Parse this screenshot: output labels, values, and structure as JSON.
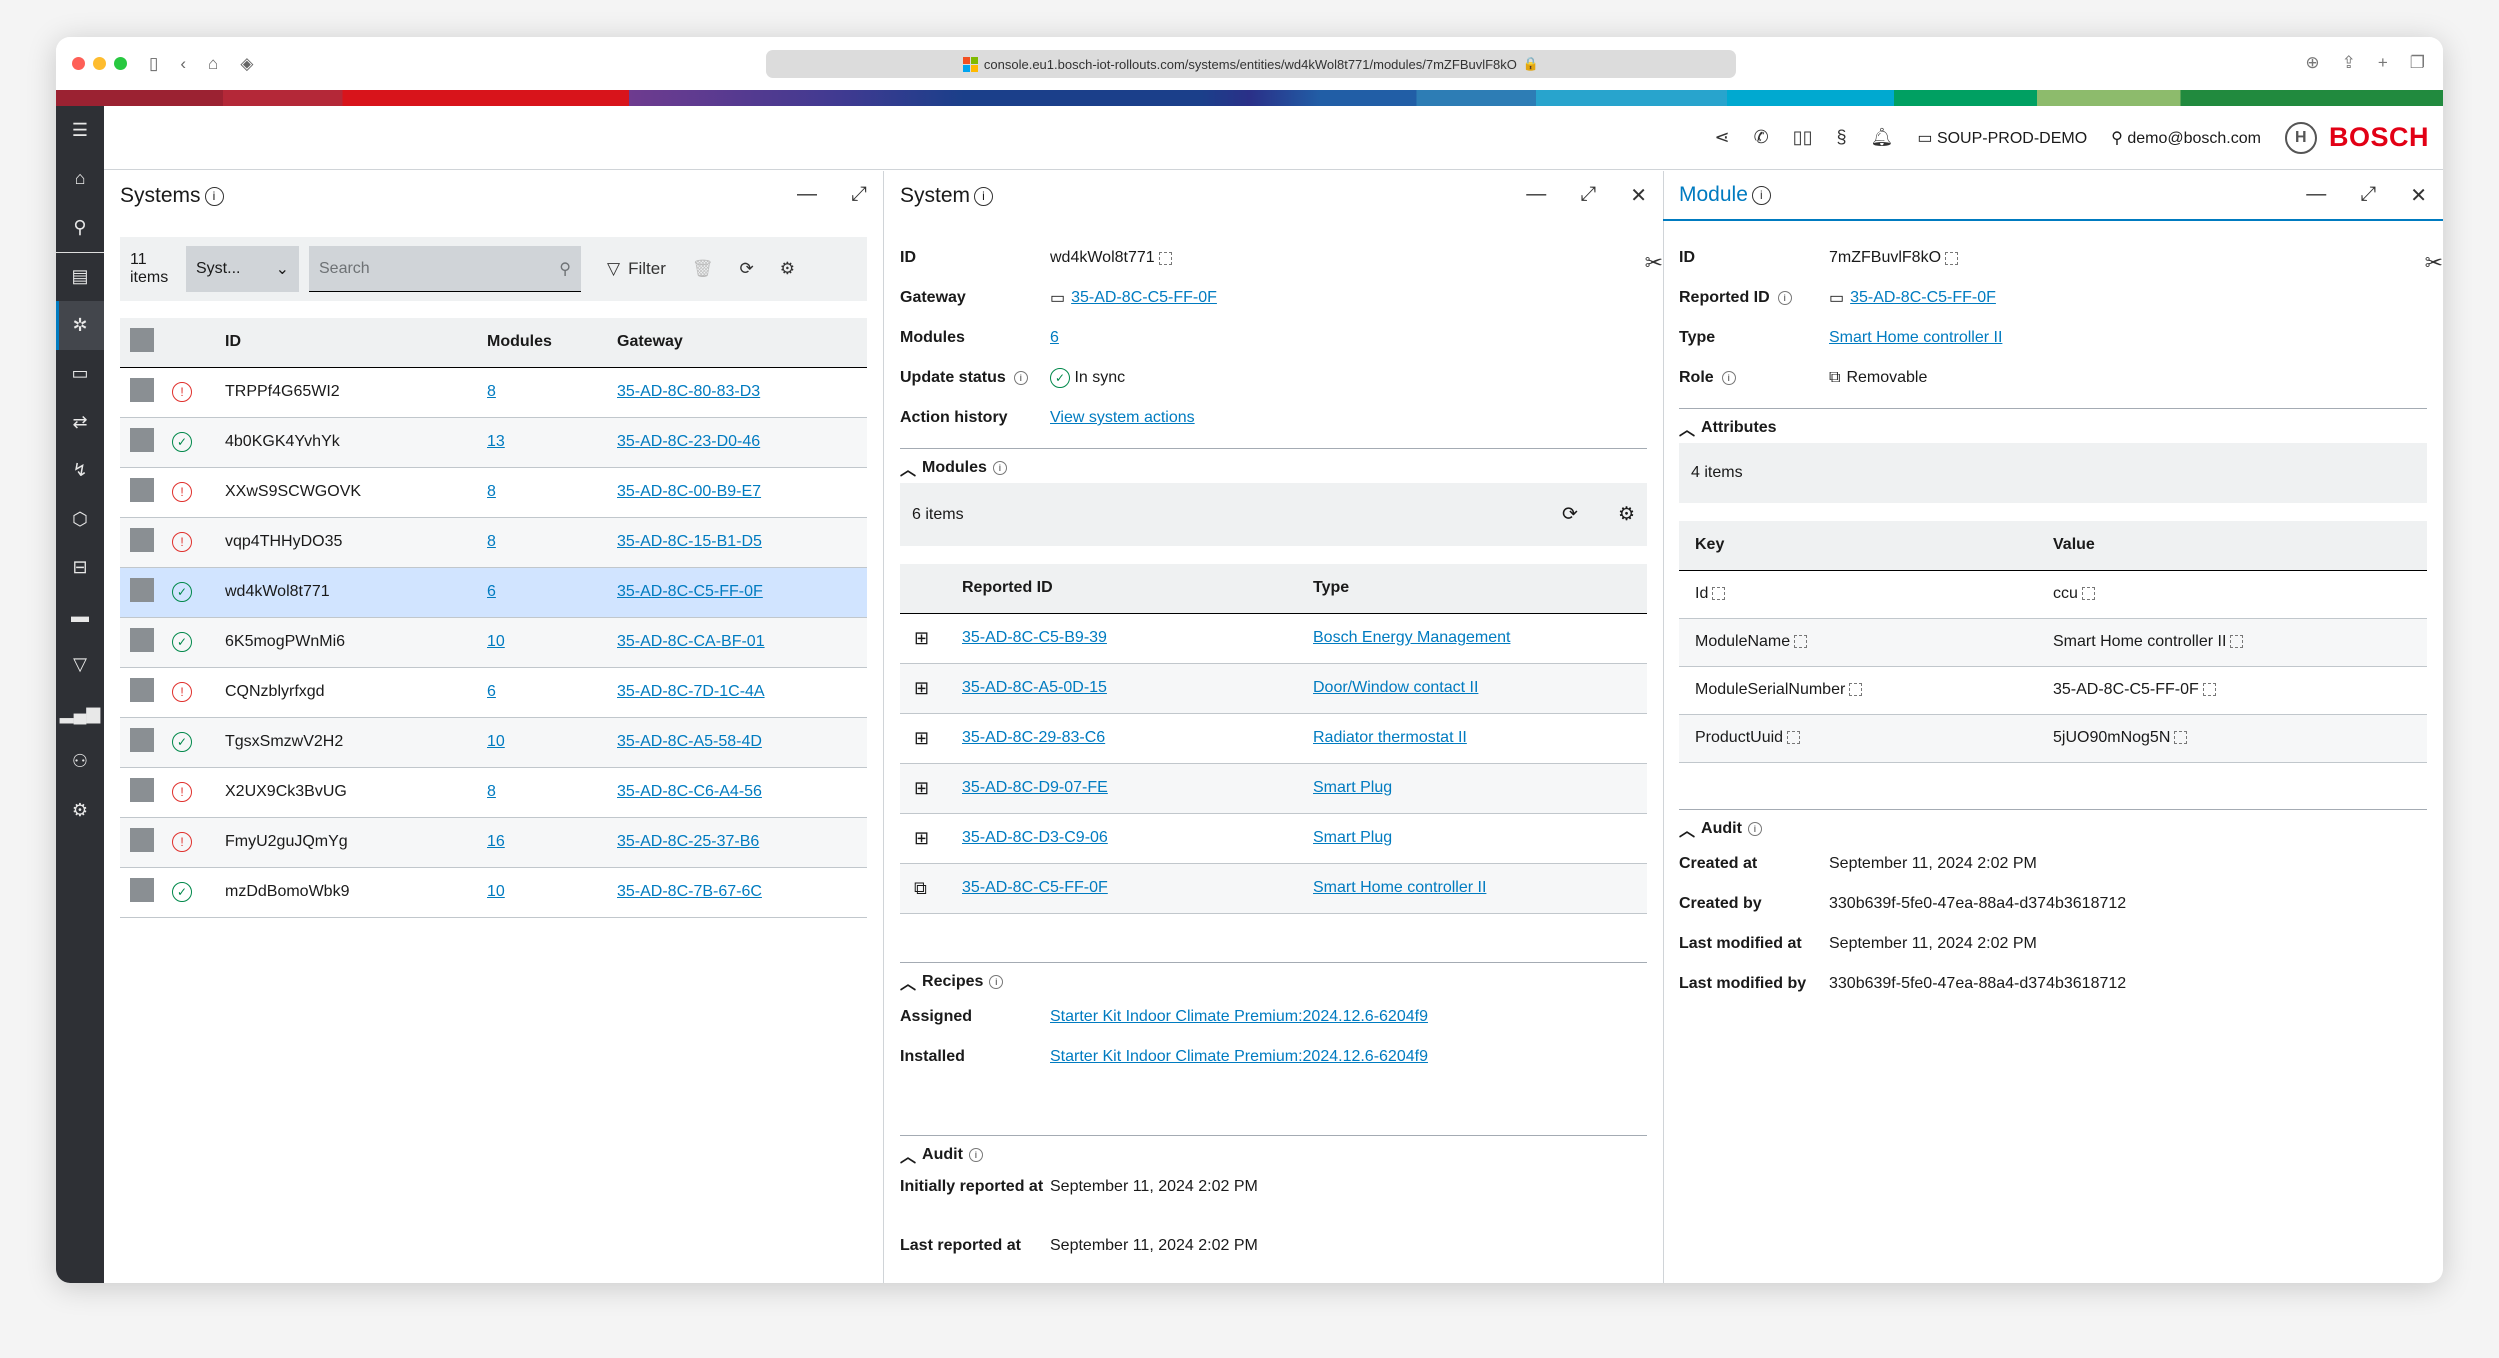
{
  "browser": {
    "url": "console.eu1.bosch-iot-rollouts.com/systems/entities/wd4kWol8t771/modules/7mZFBuvlF8kO"
  },
  "header": {
    "tenant": "SOUP-PROD-DEMO",
    "user": "demo@bosch.com",
    "brand": "BOSCH",
    "icons": [
      "share-icon",
      "phone-icon",
      "book-icon",
      "legal-icon",
      "bell-icon"
    ]
  },
  "sidebar": {
    "items": [
      "menu",
      "home",
      "search",
      "blueprint",
      "systems",
      "devices",
      "rollouts",
      "workflows",
      "packages",
      "modules",
      "bundles",
      "filter",
      "reports",
      "users",
      "settings"
    ],
    "active": "systems",
    "accent": "#007bc0"
  },
  "systems": {
    "title": "Systems",
    "count_num": "11",
    "count_label": "items",
    "type_select": "Syst...",
    "search_placeholder": "Search",
    "filter_label": "Filter",
    "columns": [
      "ID",
      "Modules",
      "Gateway"
    ],
    "rows": [
      {
        "status": "error",
        "id": "TRPPf4G65WI2",
        "modules": "8",
        "gateway": "35-AD-8C-80-83-D3"
      },
      {
        "status": "ok",
        "id": "4b0KGK4YvhYk",
        "modules": "13",
        "gateway": "35-AD-8C-23-D0-46"
      },
      {
        "status": "error",
        "id": "XXwS9SCWGOVK",
        "modules": "8",
        "gateway": "35-AD-8C-00-B9-E7"
      },
      {
        "status": "error",
        "id": "vqp4THHyDO35",
        "modules": "8",
        "gateway": "35-AD-8C-15-B1-D5"
      },
      {
        "status": "ok",
        "id": "wd4kWol8t771",
        "modules": "6",
        "gateway": "35-AD-8C-C5-FF-0F",
        "selected": true
      },
      {
        "status": "ok",
        "id": "6K5mogPWnMi6",
        "modules": "10",
        "gateway": "35-AD-8C-CA-BF-01"
      },
      {
        "status": "error",
        "id": "CQNzblyrfxgd",
        "modules": "6",
        "gateway": "35-AD-8C-7D-1C-4A"
      },
      {
        "status": "ok",
        "id": "TgsxSmzwV2H2",
        "modules": "10",
        "gateway": "35-AD-8C-A5-58-4D"
      },
      {
        "status": "error",
        "id": "X2UX9Ck3BvUG",
        "modules": "8",
        "gateway": "35-AD-8C-C6-A4-56"
      },
      {
        "status": "error",
        "id": "FmyU2guJQmYg",
        "modules": "16",
        "gateway": "35-AD-8C-25-37-B6"
      },
      {
        "status": "ok",
        "id": "mzDdBomoWbk9",
        "modules": "10",
        "gateway": "35-AD-8C-7B-67-6C"
      }
    ]
  },
  "system": {
    "title": "System",
    "fields": {
      "id_label": "ID",
      "id": "wd4kWol8t771",
      "gateway_label": "Gateway",
      "gateway": "35-AD-8C-C5-FF-0F",
      "modules_label": "Modules",
      "modules": "6",
      "update_label": "Update status",
      "update": "In sync",
      "action_label": "Action history",
      "action": "View system actions"
    },
    "modules_section": {
      "title": "Modules",
      "count": "6 items",
      "columns": [
        "Reported ID",
        "Type"
      ],
      "rows": [
        {
          "icon": "chip-icon",
          "id": "35-AD-8C-C5-B9-39",
          "type": "Bosch Energy Management"
        },
        {
          "icon": "chip-icon",
          "id": "35-AD-8C-A5-0D-15",
          "type": "Door/Window contact II"
        },
        {
          "icon": "chip-icon",
          "id": "35-AD-8C-29-83-C6",
          "type": "Radiator thermostat II"
        },
        {
          "icon": "chip-icon",
          "id": "35-AD-8C-D9-07-FE",
          "type": "Smart Plug"
        },
        {
          "icon": "chip-icon",
          "id": "35-AD-8C-D3-C9-06",
          "type": "Smart Plug"
        },
        {
          "icon": "removable-icon",
          "id": "35-AD-8C-C5-FF-0F",
          "type": "Smart Home controller II"
        }
      ]
    },
    "recipes": {
      "title": "Recipes",
      "assigned_label": "Assigned",
      "assigned": "Starter Kit Indoor Climate Premium:2024.12.6-6204f9",
      "installed_label": "Installed",
      "installed": "Starter Kit Indoor Climate Premium:2024.12.6-6204f9"
    },
    "audit": {
      "title": "Audit",
      "initial_label": "Initially reported at",
      "initial": "September 11, 2024 2:02 PM",
      "last_label": "Last reported at",
      "last": "September 11, 2024 2:02 PM"
    }
  },
  "module": {
    "title": "Module",
    "fields": {
      "id_label": "ID",
      "id": "7mZFBuvlF8kO",
      "reported_label": "Reported ID",
      "reported": "35-AD-8C-C5-FF-0F",
      "type_label": "Type",
      "type": "Smart Home controller II",
      "role_label": "Role",
      "role": "Removable"
    },
    "attributes": {
      "title": "Attributes",
      "count": "4 items",
      "columns": [
        "Key",
        "Value"
      ],
      "rows": [
        {
          "key": "Id",
          "value": "ccu"
        },
        {
          "key": "ModuleName",
          "value": "Smart Home controller II"
        },
        {
          "key": "ModuleSerialNumber",
          "value": "35-AD-8C-C5-FF-0F"
        },
        {
          "key": "ProductUuid",
          "value": "5jUO90mNog5N"
        }
      ]
    },
    "audit": {
      "title": "Audit",
      "created_at_label": "Created at",
      "created_at": "September 11, 2024 2:02 PM",
      "created_by_label": "Created by",
      "created_by": "330b639f-5fe0-47ea-88a4-d374b3618712",
      "modified_at_label": "Last modified at",
      "modified_at": "September 11, 2024 2:02 PM",
      "modified_by_label": "Last modified by",
      "modified_by": "330b639f-5fe0-47ea-88a4-d374b3618712"
    }
  }
}
